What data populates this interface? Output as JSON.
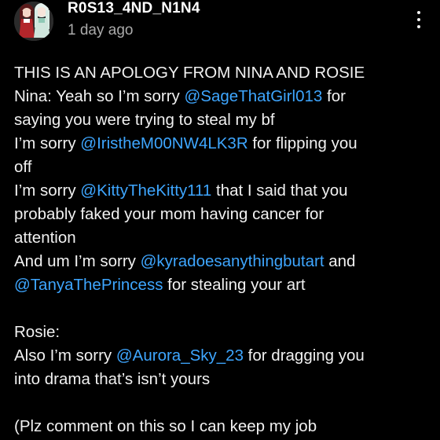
{
  "comment": {
    "author": "R0S13_4ND_N1N4",
    "timestamp": "1 day ago",
    "avatar_icon": "anime-characters-avatar",
    "more_icon": "vertical-ellipsis-icon",
    "lines": [
      [
        {
          "t": "THIS IS AN APOLOGY FROM NINA AND ROSIE"
        }
      ],
      [
        {
          "t": "Nina: Yeah so I’m sorry "
        },
        {
          "t": "@SageThatGirl013",
          "m": true
        },
        {
          "t": " for"
        }
      ],
      [
        {
          "t": "saying you were trying to steal my bf"
        }
      ],
      [
        {
          "t": "I’m sorry "
        },
        {
          "t": "@IristheM00NW4LK3R",
          "m": true
        },
        {
          "t": "  for flipping you"
        }
      ],
      [
        {
          "t": "off"
        }
      ],
      [
        {
          "t": "I’m sorry "
        },
        {
          "t": "@KittyTheKitty111",
          "m": true
        },
        {
          "t": "  that I said that you"
        }
      ],
      [
        {
          "t": "probably faked your mom having cancer for"
        }
      ],
      [
        {
          "t": "attention"
        }
      ],
      [
        {
          "t": "And um I’m sorry "
        },
        {
          "t": "@kyradoesanythingbutart",
          "m": true
        },
        {
          "t": " and"
        }
      ],
      [
        {
          "t": "@TanyaThePrincess",
          "m": true
        },
        {
          "t": " for stealing your art"
        }
      ],
      [],
      [
        {
          "t": "Rosie:"
        }
      ],
      [
        {
          "t": "Also I’m sorry "
        },
        {
          "t": "@Aurora_Sky_23",
          "m": true
        },
        {
          "t": "  for dragging you"
        }
      ],
      [
        {
          "t": "into drama that’s isn’t yours"
        }
      ],
      [],
      [
        {
          "t": "(Plz comment on this so I can keep my job"
        }
      ]
    ]
  },
  "colors": {
    "background": "#000000",
    "text": "#f1f1f1",
    "secondary": "#aaaaaa",
    "mention": "#3ea6ff"
  }
}
